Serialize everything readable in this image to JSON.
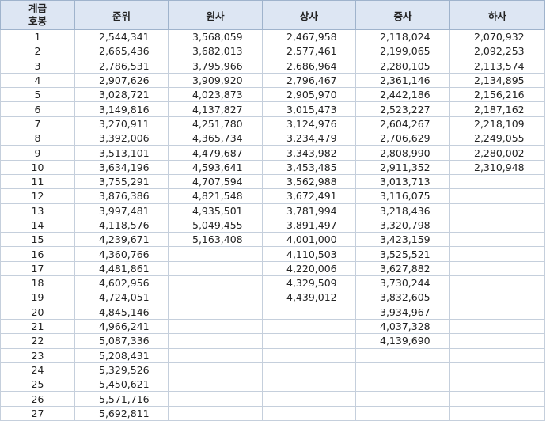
{
  "header": {
    "rowhead": "계급\n호봉",
    "columns": [
      "준위",
      "원사",
      "상사",
      "중사",
      "하사"
    ]
  },
  "rows": [
    {
      "step": "1",
      "values": [
        "2,544,341",
        "3,568,059",
        "2,467,958",
        "2,118,024",
        "2,070,932"
      ]
    },
    {
      "step": "2",
      "values": [
        "2,665,436",
        "3,682,013",
        "2,577,461",
        "2,199,065",
        "2,092,253"
      ]
    },
    {
      "step": "3",
      "values": [
        "2,786,531",
        "3,795,966",
        "2,686,964",
        "2,280,105",
        "2,113,574"
      ]
    },
    {
      "step": "4",
      "values": [
        "2,907,626",
        "3,909,920",
        "2,796,467",
        "2,361,146",
        "2,134,895"
      ]
    },
    {
      "step": "5",
      "values": [
        "3,028,721",
        "4,023,873",
        "2,905,970",
        "2,442,186",
        "2,156,216"
      ]
    },
    {
      "step": "6",
      "values": [
        "3,149,816",
        "4,137,827",
        "3,015,473",
        "2,523,227",
        "2,187,162"
      ]
    },
    {
      "step": "7",
      "values": [
        "3,270,911",
        "4,251,780",
        "3,124,976",
        "2,604,267",
        "2,218,109"
      ]
    },
    {
      "step": "8",
      "values": [
        "3,392,006",
        "4,365,734",
        "3,234,479",
        "2,706,629",
        "2,249,055"
      ]
    },
    {
      "step": "9",
      "values": [
        "3,513,101",
        "4,479,687",
        "3,343,982",
        "2,808,990",
        "2,280,002"
      ]
    },
    {
      "step": "10",
      "values": [
        "3,634,196",
        "4,593,641",
        "3,453,485",
        "2,911,352",
        "2,310,948"
      ]
    },
    {
      "step": "11",
      "values": [
        "3,755,291",
        "4,707,594",
        "3,562,988",
        "3,013,713",
        ""
      ]
    },
    {
      "step": "12",
      "values": [
        "3,876,386",
        "4,821,548",
        "3,672,491",
        "3,116,075",
        ""
      ]
    },
    {
      "step": "13",
      "values": [
        "3,997,481",
        "4,935,501",
        "3,781,994",
        "3,218,436",
        ""
      ]
    },
    {
      "step": "14",
      "values": [
        "4,118,576",
        "5,049,455",
        "3,891,497",
        "3,320,798",
        ""
      ]
    },
    {
      "step": "15",
      "values": [
        "4,239,671",
        "5,163,408",
        "4,001,000",
        "3,423,159",
        ""
      ]
    },
    {
      "step": "16",
      "values": [
        "4,360,766",
        "",
        "4,110,503",
        "3,525,521",
        ""
      ]
    },
    {
      "step": "17",
      "values": [
        "4,481,861",
        "",
        "4,220,006",
        "3,627,882",
        ""
      ]
    },
    {
      "step": "18",
      "values": [
        "4,602,956",
        "",
        "4,329,509",
        "3,730,244",
        ""
      ]
    },
    {
      "step": "19",
      "values": [
        "4,724,051",
        "",
        "4,439,012",
        "3,832,605",
        ""
      ]
    },
    {
      "step": "20",
      "values": [
        "4,845,146",
        "",
        "",
        "3,934,967",
        ""
      ]
    },
    {
      "step": "21",
      "values": [
        "4,966,241",
        "",
        "",
        "4,037,328",
        ""
      ]
    },
    {
      "step": "22",
      "values": [
        "5,087,336",
        "",
        "",
        "4,139,690",
        ""
      ]
    },
    {
      "step": "23",
      "values": [
        "5,208,431",
        "",
        "",
        "",
        ""
      ]
    },
    {
      "step": "24",
      "values": [
        "5,329,526",
        "",
        "",
        "",
        ""
      ]
    },
    {
      "step": "25",
      "values": [
        "5,450,621",
        "",
        "",
        "",
        ""
      ]
    },
    {
      "step": "26",
      "values": [
        "5,571,716",
        "",
        "",
        "",
        ""
      ]
    },
    {
      "step": "27",
      "values": [
        "5,692,811",
        "",
        "",
        "",
        ""
      ]
    }
  ]
}
